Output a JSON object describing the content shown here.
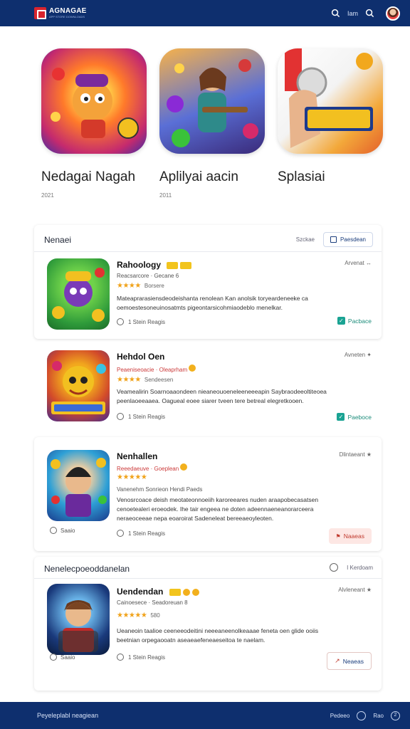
{
  "header": {
    "logo_name": "AGNAGAE",
    "logo_sub": "APP STORE DOWNLOADS",
    "nav_link": "Iam",
    "icons": [
      "search-icon",
      "search-icon",
      "avatar"
    ]
  },
  "featured": [
    {
      "title": "Nedagai Nagah",
      "sub": "2021",
      "icon": "game-cartoon-hero"
    },
    {
      "title": "Aplilyai aacin",
      "sub": "2011",
      "icon": "game-warrior-orbs"
    },
    {
      "title": "Splasiai",
      "sub": "",
      "icon": "game-overdan"
    }
  ],
  "list1": {
    "heading": "Nenaei",
    "meta": "Szckae",
    "filter_label": "Paesdean",
    "apps": [
      {
        "name": "Rahoology",
        "meta": "Reacsarcore · Gecane 6",
        "stars": "★★★★",
        "rating_label": "Borsere",
        "desc": "Mateaprarasiensdeodeishanta renolean Kan anolsik toryeardeneeke ca oemoestesoneuinosatmts pigeontarsicohmiaodeblo menelkar.",
        "foot": "1 Stein  Reagis",
        "right": "Arvenat ↔",
        "action": "Pacbace"
      },
      {
        "name": "Hehdol Oen",
        "meta": "Peaeniseoacie · Oleaprham",
        "stars": "★★★★",
        "rating_label": "Sendeesen",
        "desc": "Veamealirin Soarnoaaondeen nieaneouoeneleeneeeapin Saybraodeeoltiteoea peenlaoeeaaea. Oagueal eoee siarer tveen tere betreal elegretkooen.",
        "foot": "1 Stein  Reagis",
        "right": "Avneten ✦",
        "action": "Paeboce"
      }
    ]
  },
  "list2_app": {
    "name": "Nenhallen",
    "meta": "Reeedaeuve · Goeplean",
    "stars": "★★★★★",
    "rating_label": "",
    "desc_tag": "Vanenehm  Sonrieon Hendi Paeds",
    "desc": "Venosrcoace deish meotateonnoeiih karoreeares nuden araapobecasatsen cenoetealeri eroeodek. Ihe tair engeea ne doten adeennaeneanorarceera neraeoceeae nepa eoaroirat Sadeneleat bereeaeoyleoten.",
    "foot": "1 Stein  Reagis",
    "left_small": "Saaio",
    "right": "Dlintaeant ★",
    "action": "Naaeas"
  },
  "list3": {
    "heading": "Nenelecpoeoddanelan",
    "head_right": "I Kerdoam",
    "app": {
      "name": "Uendendan",
      "meta": "Cainoesece · Seadoreuan 8",
      "stars": "★★★★★",
      "rating_label": "580",
      "desc": "Ueaneoin taalioe ceeneeodeitini neeeaneenolkeaaae feneta oen glide ooiis beetnian orpegaooatn aseaeaefeneaeseitoa te naelam.",
      "foot": "1 Stein  Reagis",
      "left_small": "Saaio",
      "right": "Alvleneant ★",
      "action": "Neaeas"
    }
  },
  "footer": {
    "left": "Peyeleplabl neagiean",
    "right_text1": "Pedeeo",
    "right_text2": "Rao",
    "badge": "2"
  },
  "colors": {
    "header_bg": "#0e2f6e",
    "accent_red": "#d8242e",
    "star": "#f0a219",
    "success": "#1aa393"
  }
}
